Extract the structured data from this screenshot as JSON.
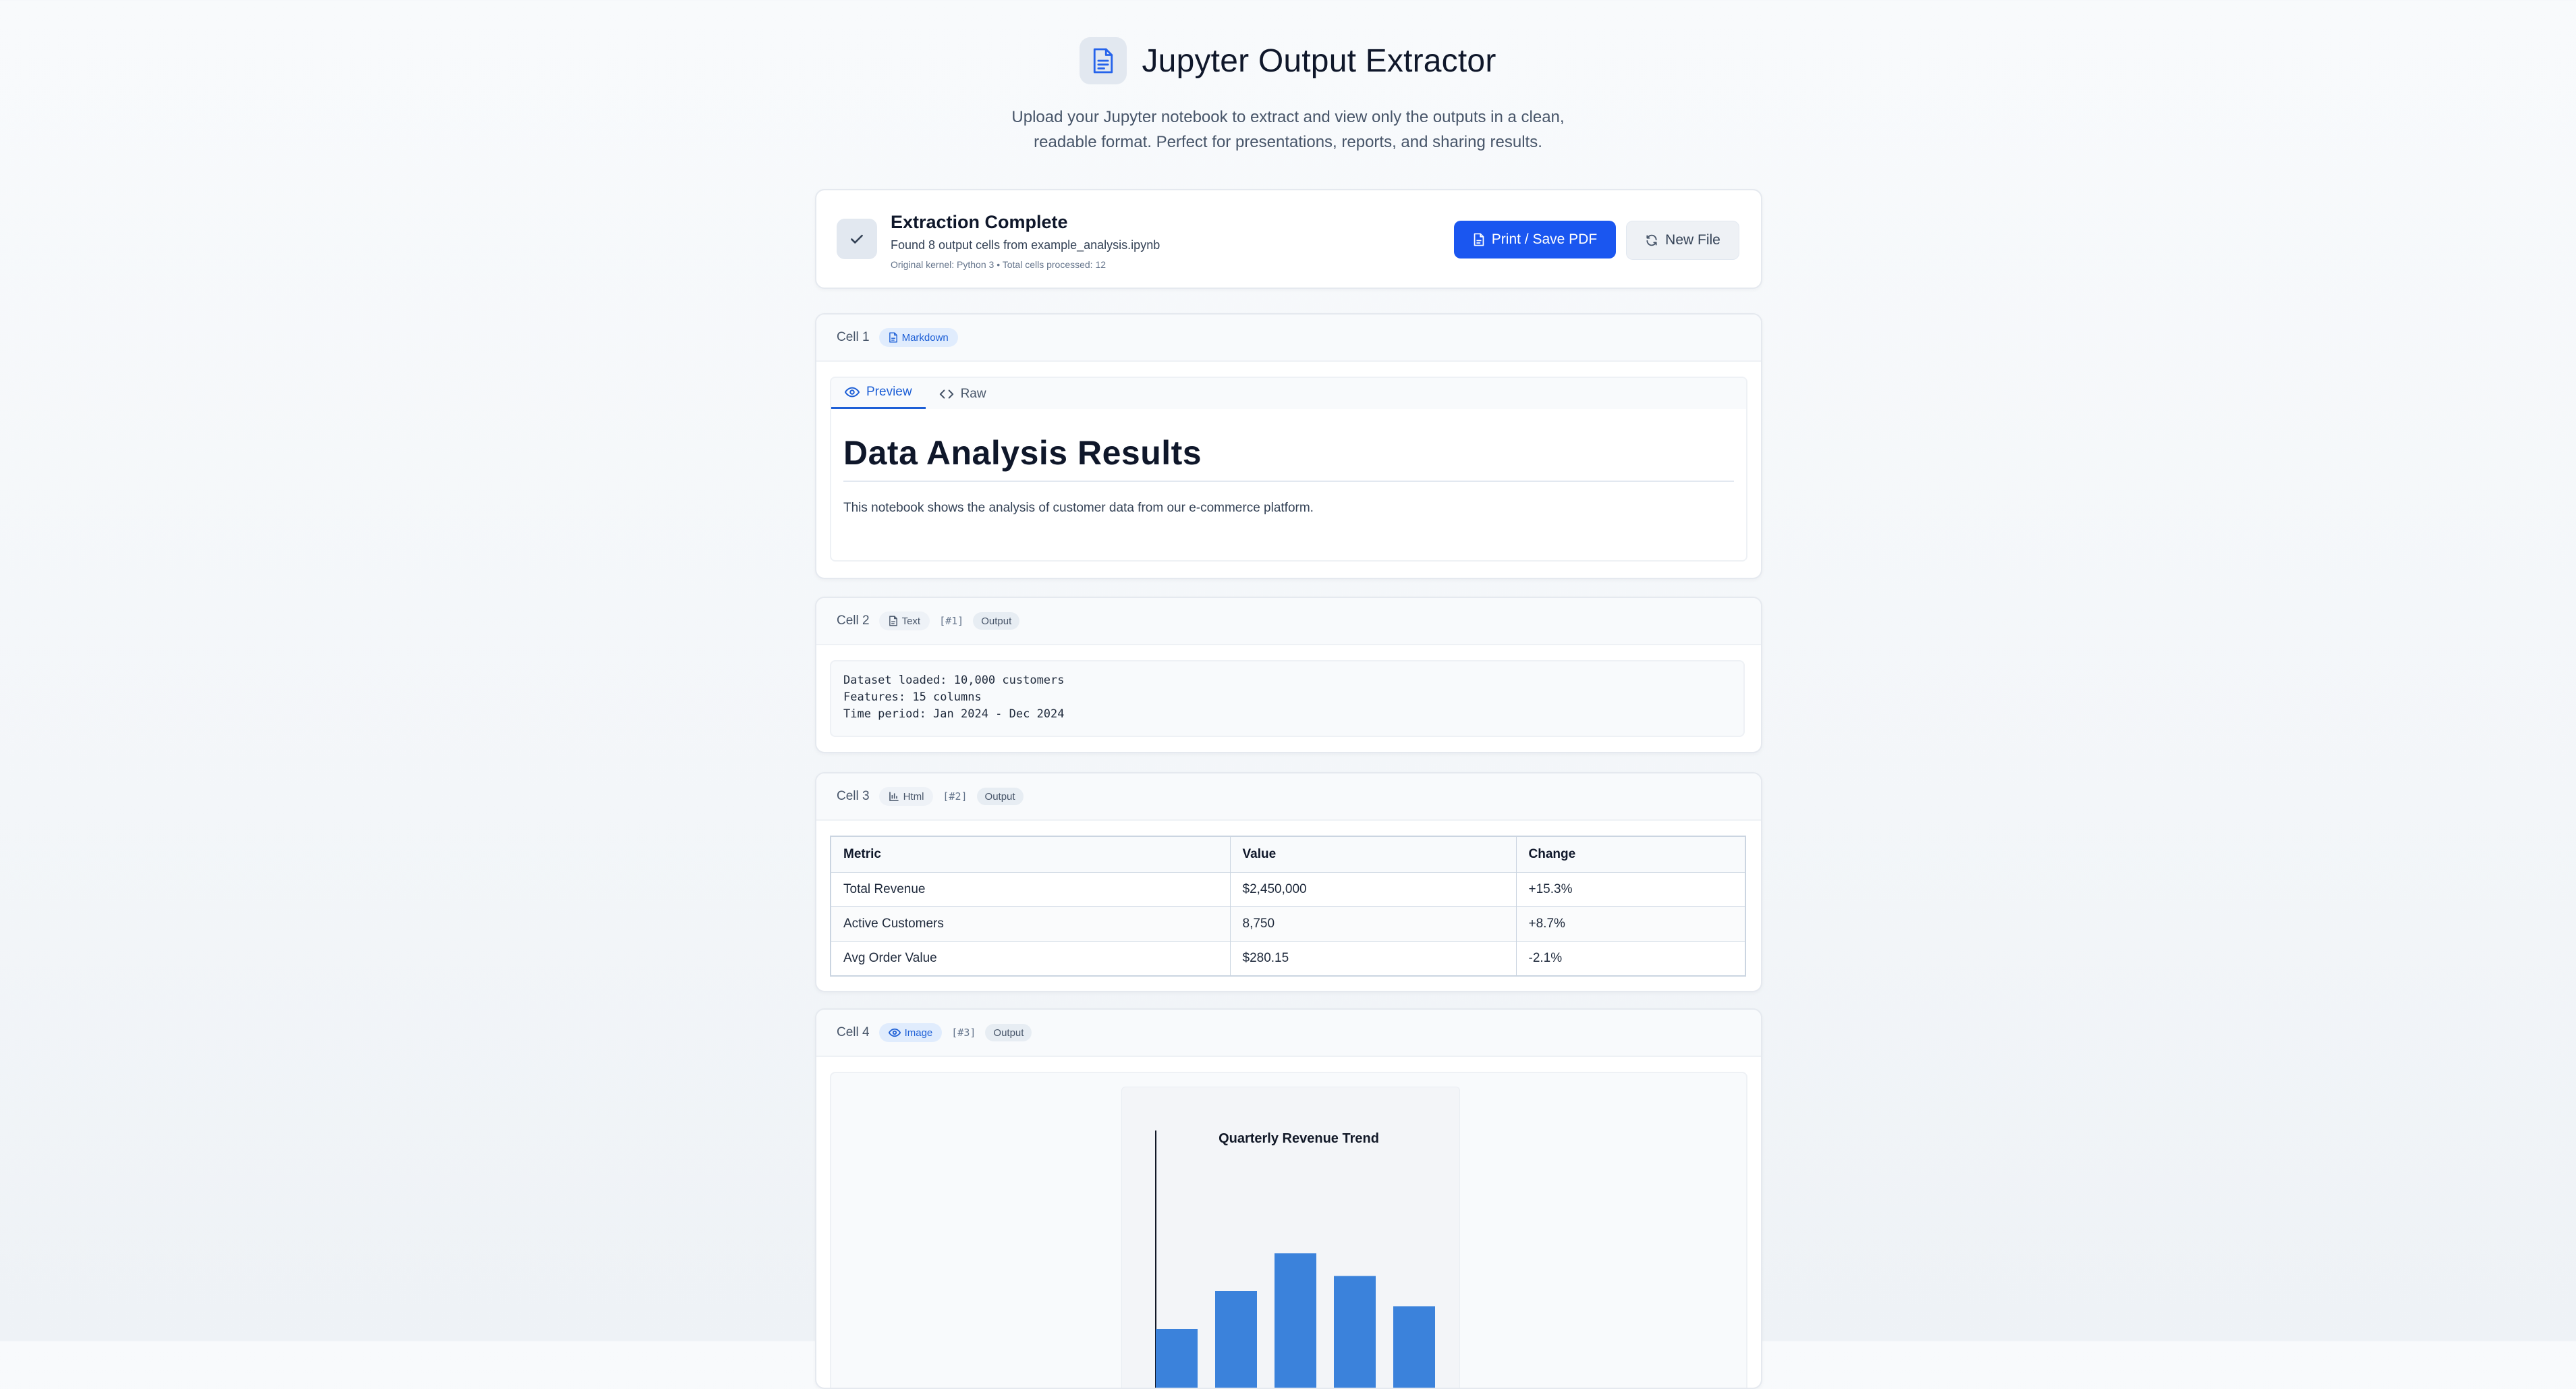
{
  "app": {
    "title": "Jupyter Output Extractor",
    "subtitle": "Upload your Jupyter notebook to extract and view only the outputs in a clean, readable format. Perfect for presentations, reports, and sharing results."
  },
  "status": {
    "title": "Extraction Complete",
    "summary": "Found 8 output cells from example_analysis.ipynb",
    "meta": "Original kernel: Python 3 • Total cells processed: 12",
    "print_label": "Print / Save PDF",
    "new_file_label": "New File"
  },
  "cells": [
    {
      "label": "Cell 1",
      "type": "Markdown",
      "tabs": [
        "Preview",
        "Raw"
      ],
      "heading": "Data Analysis Results",
      "paragraph": "This notebook shows the analysis of customer data from our e-commerce platform."
    },
    {
      "label": "Cell 2",
      "type": "Text",
      "exec": "[#1]",
      "output_badge": "Output",
      "lines": [
        "Dataset loaded: 10,000 customers",
        "Features: 15 columns",
        "Time period: Jan 2024 - Dec 2024"
      ]
    },
    {
      "label": "Cell 3",
      "type": "Html",
      "exec": "[#2]",
      "output_badge": "Output",
      "table": {
        "headers": [
          "Metric",
          "Value",
          "Change"
        ],
        "rows": [
          [
            "Total Revenue",
            "$2,450,000",
            "+15.3%"
          ],
          [
            "Active Customers",
            "8,750",
            "+8.7%"
          ],
          [
            "Avg Order Value",
            "$280.15",
            "-2.1%"
          ]
        ]
      }
    },
    {
      "label": "Cell 4",
      "type": "Image",
      "exec": "[#3]",
      "output_badge": "Output"
    }
  ],
  "chart_data": {
    "type": "bar",
    "title": "Quarterly Revenue Trend",
    "values": [
      0.4,
      0.6,
      0.8,
      0.68,
      0.52
    ],
    "ylim": [
      0,
      1
    ],
    "color": "#3b82db"
  },
  "colors": {
    "accent": "#1a56f0",
    "badge_blue_text": "#1d5fd6",
    "bar": "#3b82db"
  }
}
